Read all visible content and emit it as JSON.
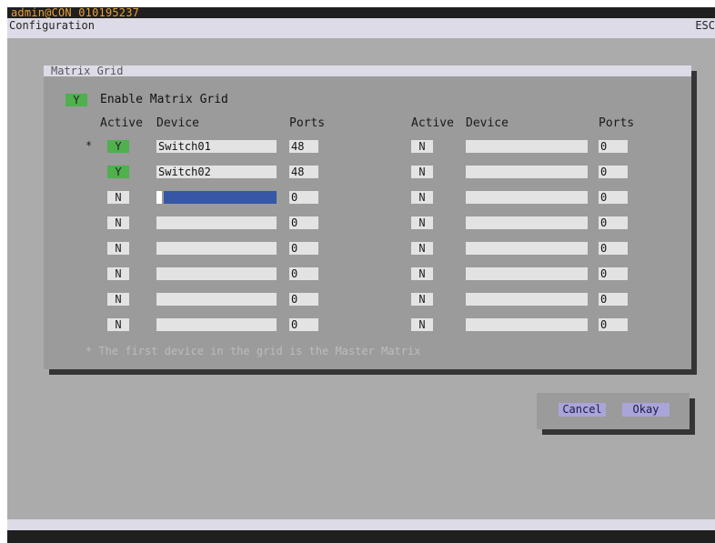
{
  "topbar": {
    "user": "admin@CON 010195237"
  },
  "menubar": {
    "title": "Configuration",
    "esc": "ESC"
  },
  "panel": {
    "title": "Matrix Grid",
    "enable": {
      "value": "Y",
      "label": "Enable Matrix Grid"
    },
    "columns": {
      "active": "Active",
      "device": "Device",
      "ports": "Ports"
    },
    "master_marker": "*",
    "left_rows": [
      {
        "active": "Y",
        "device": "Switch01",
        "ports": "48"
      },
      {
        "active": "Y",
        "device": "Switch02",
        "ports": "48"
      },
      {
        "active": "N",
        "device": "",
        "ports": "0"
      },
      {
        "active": "N",
        "device": "",
        "ports": "0"
      },
      {
        "active": "N",
        "device": "",
        "ports": "0"
      },
      {
        "active": "N",
        "device": "",
        "ports": "0"
      },
      {
        "active": "N",
        "device": "",
        "ports": "0"
      },
      {
        "active": "N",
        "device": "",
        "ports": "0"
      }
    ],
    "right_rows": [
      {
        "active": "N",
        "device": "",
        "ports": "0"
      },
      {
        "active": "N",
        "device": "",
        "ports": "0"
      },
      {
        "active": "N",
        "device": "",
        "ports": "0"
      },
      {
        "active": "N",
        "device": "",
        "ports": "0"
      },
      {
        "active": "N",
        "device": "",
        "ports": "0"
      },
      {
        "active": "N",
        "device": "",
        "ports": "0"
      },
      {
        "active": "N",
        "device": "",
        "ports": "0"
      },
      {
        "active": "N",
        "device": "",
        "ports": "0"
      }
    ],
    "note": "* The first device in the grid is the Master Matrix"
  },
  "buttons": {
    "cancel": "Cancel",
    "okay": "Okay"
  },
  "colors": {
    "active_flag": "#4fb04d",
    "inactive_flag": "#e3e3e3",
    "edit_highlight": "#3557a6",
    "button": "#a9a5d9"
  }
}
